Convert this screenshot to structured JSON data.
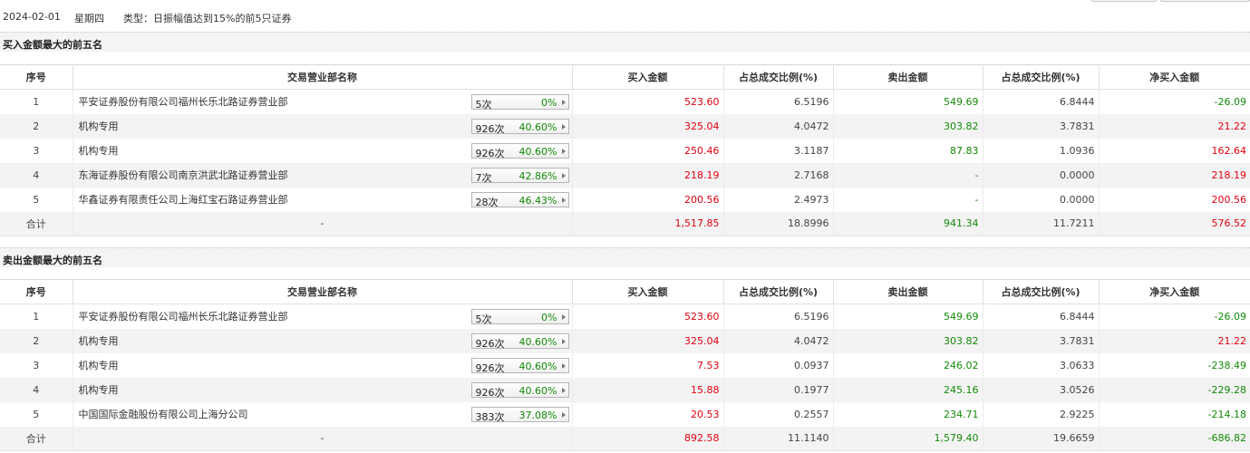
{
  "header": {
    "date": "2024-02-01",
    "weekday": "星期四",
    "type_text": "类型：日振幅值达到15%的前5只证券"
  },
  "sections": {
    "buy": {
      "title": "买入金额最大的前五名"
    },
    "sell": {
      "title": "卖出金额最大的前五名"
    }
  },
  "columns": [
    "序号",
    "交易营业部名称",
    "买入金额",
    "占总成交比例(%)",
    "卖出金额",
    "占总成交比例(%)",
    "净买入金额"
  ],
  "buy_table": {
    "rows": [
      {
        "idx": "1",
        "name": "平安证券股份有限公司福州长乐北路证券营业部",
        "count": "5次",
        "rate": "0%",
        "buy": "523.60",
        "buy_pct": "6.5196",
        "sell": "549.69",
        "sell_pct": "6.8444",
        "net": "-26.09"
      },
      {
        "idx": "2",
        "name": "机构专用",
        "count": "926次",
        "rate": "40.60%",
        "buy": "325.04",
        "buy_pct": "4.0472",
        "sell": "303.82",
        "sell_pct": "3.7831",
        "net": "21.22"
      },
      {
        "idx": "3",
        "name": "机构专用",
        "count": "926次",
        "rate": "40.60%",
        "buy": "250.46",
        "buy_pct": "3.1187",
        "sell": "87.83",
        "sell_pct": "1.0936",
        "net": "162.64"
      },
      {
        "idx": "4",
        "name": "东海证券股份有限公司南京洪武北路证券营业部",
        "count": "7次",
        "rate": "42.86%",
        "buy": "218.19",
        "buy_pct": "2.7168",
        "sell": "-",
        "sell_pct": "0.0000",
        "net": "218.19"
      },
      {
        "idx": "5",
        "name": "华鑫证券有限责任公司上海红宝石路证券营业部",
        "count": "28次",
        "rate": "46.43%",
        "buy": "200.56",
        "buy_pct": "2.4973",
        "sell": "-",
        "sell_pct": "0.0000",
        "net": "200.56"
      }
    ],
    "total": {
      "label": "合计",
      "name": "-",
      "buy": "1,517.85",
      "buy_pct": "18.8996",
      "sell": "941.34",
      "sell_pct": "11.7211",
      "net": "576.52"
    }
  },
  "sell_table": {
    "rows": [
      {
        "idx": "1",
        "name": "平安证券股份有限公司福州长乐北路证券营业部",
        "count": "5次",
        "rate": "0%",
        "buy": "523.60",
        "buy_pct": "6.5196",
        "sell": "549.69",
        "sell_pct": "6.8444",
        "net": "-26.09"
      },
      {
        "idx": "2",
        "name": "机构专用",
        "count": "926次",
        "rate": "40.60%",
        "buy": "325.04",
        "buy_pct": "4.0472",
        "sell": "303.82",
        "sell_pct": "3.7831",
        "net": "21.22"
      },
      {
        "idx": "3",
        "name": "机构专用",
        "count": "926次",
        "rate": "40.60%",
        "buy": "7.53",
        "buy_pct": "0.0937",
        "sell": "246.02",
        "sell_pct": "3.0633",
        "net": "-238.49"
      },
      {
        "idx": "4",
        "name": "机构专用",
        "count": "926次",
        "rate": "40.60%",
        "buy": "15.88",
        "buy_pct": "0.1977",
        "sell": "245.16",
        "sell_pct": "3.0526",
        "net": "-229.28"
      },
      {
        "idx": "5",
        "name": "中国国际金融股份有限公司上海分公司",
        "count": "383次",
        "rate": "37.08%",
        "buy": "20.53",
        "buy_pct": "0.2557",
        "sell": "234.71",
        "sell_pct": "2.9225",
        "net": "-214.18"
      }
    ],
    "total": {
      "label": "合计",
      "name": "-",
      "buy": "892.58",
      "buy_pct": "11.1140",
      "sell": "1,579.40",
      "sell_pct": "19.6659",
      "net": "-686.82"
    }
  },
  "colors": {
    "up": "#e0000f",
    "down": "#138a07"
  }
}
